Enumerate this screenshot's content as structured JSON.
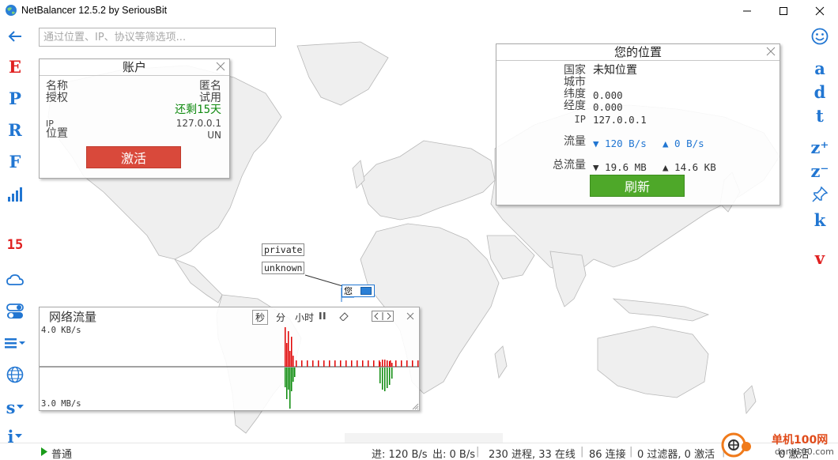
{
  "window": {
    "title": "NetBalancer 12.5.2 by SeriousBit"
  },
  "search": {
    "placeholder": "通过位置、IP、协议等筛选项..."
  },
  "left_bar": {
    "items": [
      {
        "name": "back",
        "label": ""
      },
      {
        "name": "e",
        "label": "E"
      },
      {
        "name": "p",
        "label": "P"
      },
      {
        "name": "r",
        "label": "R"
      },
      {
        "name": "f",
        "label": "F"
      },
      {
        "name": "stats",
        "label": ""
      },
      {
        "name": "days",
        "label": "15"
      },
      {
        "name": "cloud",
        "label": ""
      },
      {
        "name": "toggle",
        "label": ""
      },
      {
        "name": "menu",
        "label": ""
      },
      {
        "name": "globe",
        "label": ""
      },
      {
        "name": "s",
        "label": "s"
      },
      {
        "name": "i",
        "label": "i"
      }
    ]
  },
  "right_bar": {
    "items": [
      {
        "name": "smiley",
        "label": ""
      },
      {
        "name": "a",
        "label": "a"
      },
      {
        "name": "d",
        "label": "d"
      },
      {
        "name": "t",
        "label": "t"
      },
      {
        "name": "zoom-in",
        "label": "z⁺"
      },
      {
        "name": "zoom-out",
        "label": "z⁻"
      },
      {
        "name": "pin",
        "label": ""
      },
      {
        "name": "k",
        "label": "k"
      },
      {
        "name": "v",
        "label": "v"
      }
    ]
  },
  "account": {
    "title": "账户",
    "name_label": "名称",
    "license_label": "授权",
    "name_value": "匿名",
    "license_value": "试用",
    "remaining_prefix": "还剩",
    "remaining_days": "15",
    "remaining_suffix": "天",
    "ip_label": "IP",
    "location_label": "位置",
    "ip_value": "127.0.0.1",
    "location_value": "UN",
    "activate_button": "激活"
  },
  "location": {
    "title": "您的位置",
    "country_label": "国家",
    "country_value": "未知位置",
    "city_label": "城市",
    "city_value": "",
    "lat_label": "纬度",
    "lat_value": "0.000",
    "lon_label": "经度",
    "lon_value": "0.000",
    "ip_label": "IP",
    "ip_value": "127.0.0.1",
    "traffic_label": "流量",
    "traffic_down": "▼ 120 B/s",
    "traffic_up": "▲ 0 B/s",
    "total_label": "总流量",
    "total_down": "▼ 19.6 MB",
    "total_up": "▲ 14.6 KB",
    "refresh_button": "刷新"
  },
  "map_tags": {
    "private": "private",
    "unknown": "unknown",
    "you": "您"
  },
  "traffic": {
    "title": "网络流量",
    "tabs": [
      "秒",
      "分",
      "小时"
    ],
    "top_label": "4.0 KB/s",
    "bottom_label": "3.0 MB/s",
    "colors": {
      "download": "#e00000",
      "upload": "#0a8a0a"
    }
  },
  "status": {
    "mode": "普通",
    "in": "进: 120 B/s",
    "out": "出: 0 B/s",
    "processes": "230 进程, 33 在线",
    "connections": "86 连接",
    "filters": "0 过滤器, 0 激活",
    "rules": "0 规则, 0 激活",
    "rules_visible": "0 激活"
  },
  "watermark": {
    "site": "单机100网",
    "url": "danji100.com"
  }
}
